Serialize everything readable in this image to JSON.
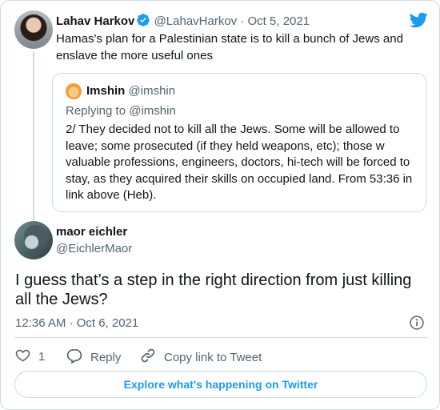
{
  "parent_tweet": {
    "name": "Lahav Harkov",
    "handle": "@LahavHarkov",
    "separator": "·",
    "date": "Oct 5, 2021",
    "text": "Hamas's plan for a Palestinian state is to kill a bunch of Jews and enslave the more useful ones",
    "verified_icon": "verified-badge-icon",
    "brand_icon": "twitter-bird-icon"
  },
  "quoted_tweet": {
    "name": "Imshin",
    "handle": "@imshin",
    "replying_to": "Replying to @imshin",
    "text": "2/ They decided not to kill all the Jews. Some will be allowed to leave; some prosecuted (if they held weapons, etc); those w valuable professions, engineers, doctors, hi-tech will be forced to stay, as they acquired their skills on occupied land. From 53:36 in link above (Heb)."
  },
  "main_tweet": {
    "name": "maor eichler",
    "handle": "@EichlerMaor",
    "text": "I guess that’s a step in the right direction from just killing all the Jews?",
    "timestamp": "12:36 AM · Oct 6, 2021",
    "info_icon": "info-icon"
  },
  "actions": {
    "like_count": "1",
    "reply_label": "Reply",
    "copy_label": "Copy link to Tweet"
  },
  "footer": {
    "explore_label": "Explore what's happening on Twitter"
  },
  "colors": {
    "accent": "#1d9bf0",
    "secondary_text": "#536471",
    "border": "#cfd9de"
  }
}
